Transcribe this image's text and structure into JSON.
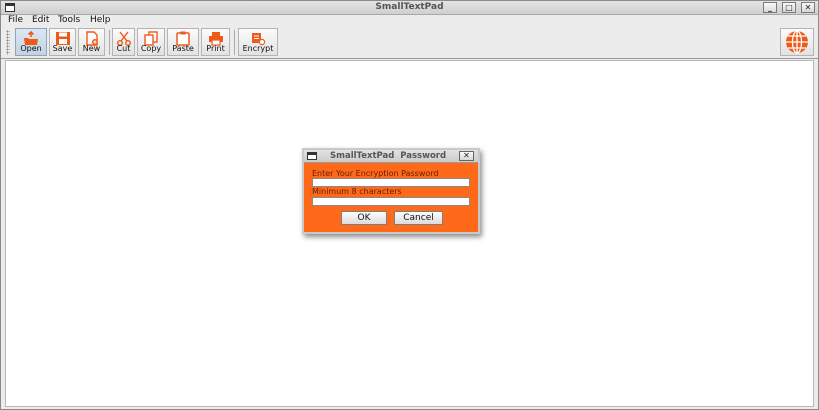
{
  "window": {
    "title": "SmallTextPad",
    "controls": {
      "minimize": "_",
      "maximize": "□",
      "close": "✕"
    }
  },
  "menu": [
    "File",
    "Edit",
    "Tools",
    "Help"
  ],
  "toolbar": {
    "buttons": [
      {
        "label": "Open",
        "icon": "open-folder-icon"
      },
      {
        "label": "Save",
        "icon": "floppy-disk-icon"
      },
      {
        "label": "New",
        "icon": "new-document-icon"
      },
      {
        "label": "Cut",
        "icon": "scissors-icon"
      },
      {
        "label": "Copy",
        "icon": "copy-icon"
      },
      {
        "label": "Paste",
        "icon": "clipboard-icon"
      },
      {
        "label": "Print",
        "icon": "printer-icon"
      },
      {
        "label": "Encrypt",
        "icon": "encrypt-icon"
      }
    ],
    "right_icon": "globe-icon"
  },
  "editor": {
    "content": ""
  },
  "dialog": {
    "title": "SmallTextPad  Password",
    "close": "✕",
    "label1": "Enter Your Encryption Password",
    "label2": "Minimum 8 characters",
    "input1_value": "",
    "input2_value": "",
    "ok_label": "OK",
    "cancel_label": "Cancel"
  },
  "colors": {
    "accent": "#ff6a1a",
    "icon": "#ee5a1a",
    "editor_bg": "#ffffff",
    "chrome": "#ececec"
  }
}
